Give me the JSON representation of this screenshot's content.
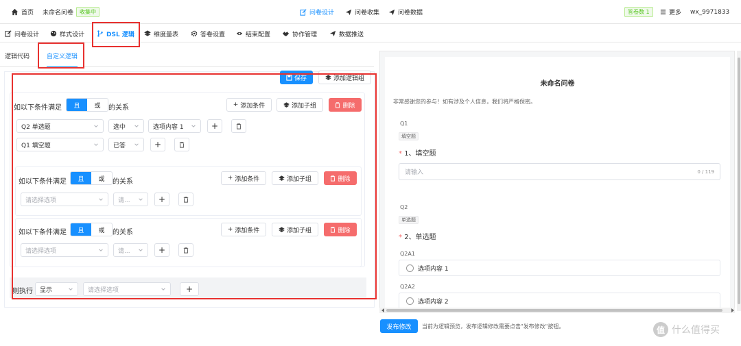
{
  "topbar": {
    "home": "首页",
    "survey_name": "未命名问卷",
    "status_badge": "收集中",
    "design": "问卷设计",
    "collect": "问卷收集",
    "data": "问卷数据",
    "answer_count": "答卷数 1",
    "more": "更多",
    "user": "wx_9971833"
  },
  "tabs": [
    {
      "label": "问卷设计",
      "icon": "edit-icon"
    },
    {
      "label": "样式设计",
      "icon": "palette-icon"
    },
    {
      "label": "DSL 逻辑",
      "icon": "branch-icon"
    },
    {
      "label": "维度量表",
      "icon": "layers-icon"
    },
    {
      "label": "答卷设置",
      "icon": "gear-icon"
    },
    {
      "label": "结束配置",
      "icon": "eye-icon"
    },
    {
      "label": "协作管理",
      "icon": "handshake-icon"
    },
    {
      "label": "数据推送",
      "icon": "send-icon"
    }
  ],
  "subtabs": {
    "code": "逻辑代码",
    "custom": "自定义逻辑"
  },
  "editor": {
    "save": "保存",
    "add_group": "添加逻辑组",
    "cond_prefix": "如以下条件满足",
    "and": "且",
    "or": "或",
    "cond_suffix": "的关系",
    "add_condition": "添加条件",
    "add_subgroup": "添加子组",
    "delete": "删除",
    "row1": {
      "field": "Q2 单选题",
      "op": "选中",
      "value": "选项内容 1"
    },
    "row2": {
      "field": "Q1 填空题",
      "op": "已答"
    },
    "placeholder_option": "请选择选项",
    "placeholder_short": "请...",
    "then_label": "则执行",
    "then_action": "显示"
  },
  "preview": {
    "title": "未命名问卷",
    "desc": "非常感谢您的参与！如有涉及个人信息，我们将严格保密。",
    "q1": {
      "code": "Q1",
      "type": "填空题",
      "title": "1、填空题",
      "placeholder": "请输入",
      "count": "0 / 119"
    },
    "q2": {
      "code": "Q2",
      "type": "单选题",
      "title": "2、单选题",
      "options": [
        {
          "code": "Q2A1",
          "label": "选项内容 1"
        },
        {
          "code": "Q2A2",
          "label": "选项内容 2"
        }
      ]
    }
  },
  "footer": {
    "publish": "发布修改",
    "note": "当前为逻辑预览，发布逻辑修改需要点击\"发布修改\"按钮。",
    "watermark": "什么值得买"
  },
  "colors": {
    "accent": "#1890ff",
    "danger": "#f56c6c",
    "annotation_red": "#e8312f",
    "green": "#52c41a"
  }
}
